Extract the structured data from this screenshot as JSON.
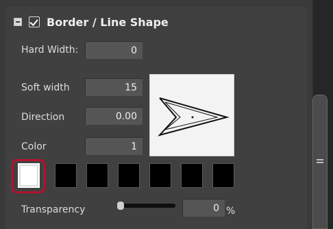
{
  "section": {
    "title": "Border / Line Shape"
  },
  "fields": {
    "hard_width": {
      "label": "Hard Width:",
      "value": "0"
    },
    "soft_width": {
      "label": "Soft width",
      "value": "15"
    },
    "direction": {
      "label": "Direction",
      "value": "0.00"
    },
    "color": {
      "label": "Color",
      "value": "1"
    },
    "transparency": {
      "label": "Transparency",
      "value": "0",
      "unit": "%"
    }
  },
  "swatches": {
    "selected_index": 0,
    "colors": [
      "#ffffff",
      "#000000",
      "#000000",
      "#000000",
      "#000000",
      "#000000",
      "#000000"
    ]
  },
  "slider": {
    "transparency_fraction": 0
  },
  "icons": {
    "collapse": "collapse-icon",
    "checkbox": "checkbox-icon"
  },
  "colors": {
    "panel_bg": "#404040",
    "highlight": "#b3122e"
  }
}
